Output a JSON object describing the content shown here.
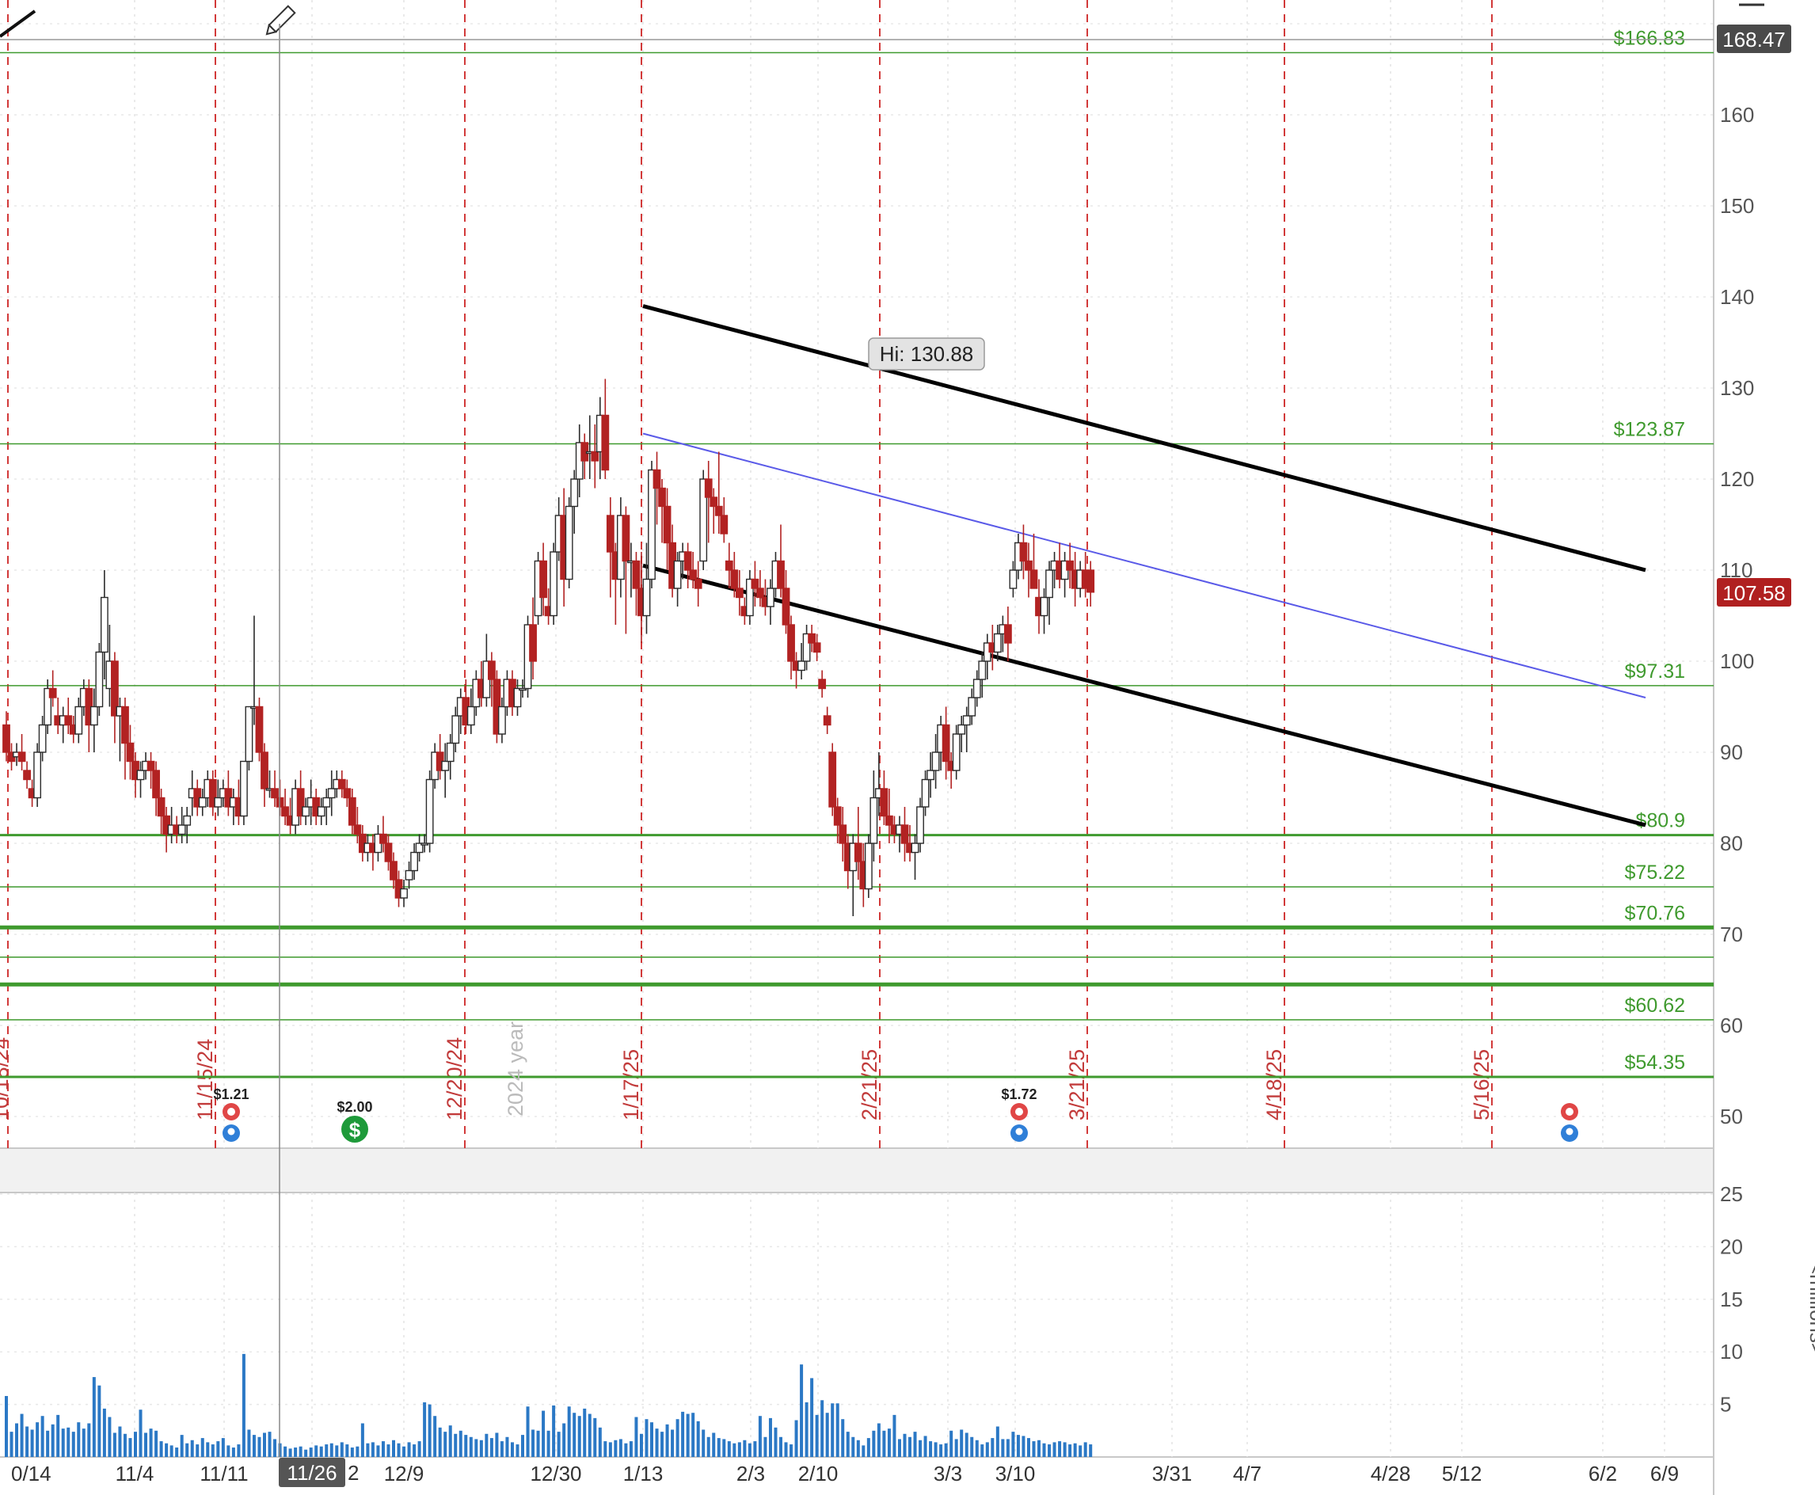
{
  "chart_data": {
    "type": "candlestick",
    "price_axis": {
      "ticks": [
        "160",
        "150",
        "140",
        "130",
        "120",
        "110",
        "100",
        "90",
        "80",
        "70",
        "60",
        "50"
      ],
      "tick_values": [
        160,
        150,
        140,
        130,
        120,
        110,
        100,
        90,
        80,
        70,
        60,
        50
      ],
      "ylim": [
        46,
        172
      ]
    },
    "volume_axis": {
      "ticks": [
        "25",
        "20",
        "15",
        "10",
        "5"
      ],
      "tick_values": [
        25,
        20,
        15,
        10,
        5
      ],
      "unit_label": "<millions>",
      "ylim": [
        0,
        27
      ]
    },
    "x_axis": {
      "ticks": [
        "0/14",
        "11/4",
        "11/11",
        "11/26",
        "12/9",
        "12/30",
        "1/13",
        "2/3",
        "2/10",
        "3/3",
        "3/10",
        "3/31",
        "4/7",
        "4/28",
        "5/12",
        "6/2",
        "6/9"
      ],
      "selected_tick": "11/26",
      "selected_tick_suffix": "2",
      "year_marker": "2024 year"
    },
    "current_price": "107.58",
    "cursor_price": "168.47",
    "high_annotation": "Hi: 130.88",
    "price_levels": [
      {
        "label": "$166.83",
        "value": 166.83,
        "weight": "thin"
      },
      {
        "label": "$123.87",
        "value": 123.87,
        "weight": "thin"
      },
      {
        "label": "$97.31",
        "value": 97.31,
        "weight": "thin"
      },
      {
        "label": "$80.9",
        "value": 80.9,
        "weight": "medium"
      },
      {
        "label": "$75.22",
        "value": 75.22,
        "weight": "thin"
      },
      {
        "label": "$70.76",
        "value": 70.76,
        "weight": "thick"
      },
      {
        "label": "",
        "value": 67.5,
        "weight": "thin"
      },
      {
        "label": "",
        "value": 64.5,
        "weight": "thick"
      },
      {
        "label": "$60.62",
        "value": 60.62,
        "weight": "thin"
      },
      {
        "label": "$54.35",
        "value": 54.35,
        "weight": "medium"
      }
    ],
    "event_dates": [
      "11/15/24",
      "12/20/24",
      "1/17/25",
      "2/21/25",
      "3/21/25",
      "4/18/25",
      "5/16/25"
    ],
    "partial_event_date": "10/18/24",
    "dividends": [
      {
        "label": "$1.21"
      },
      {
        "label": "$2.00"
      },
      {
        "label": "$1.72"
      }
    ],
    "channel": {
      "upper": {
        "start": [
          "1/17",
          139
        ],
        "end": [
          "5/30",
          110
        ]
      },
      "middle": {
        "start": [
          "1/17",
          125
        ],
        "end": [
          "5/30",
          96
        ]
      },
      "lower": {
        "start": [
          "1/17",
          110.5
        ],
        "end": [
          "5/30",
          82
        ]
      }
    },
    "candles": [
      [
        93,
        94.5,
        89,
        90
      ],
      [
        90,
        91,
        88,
        89
      ],
      [
        89.5,
        91,
        88.5,
        90
      ],
      [
        90,
        92,
        88,
        89
      ],
      [
        88,
        89,
        86,
        87
      ],
      [
        86,
        87,
        84,
        85
      ],
      [
        85,
        91,
        84,
        90
      ],
      [
        90,
        94,
        89,
        93
      ],
      [
        93,
        98,
        92,
        97
      ],
      [
        97,
        99,
        95,
        96
      ],
      [
        94,
        96,
        92,
        93
      ],
      [
        93,
        95,
        91,
        94
      ],
      [
        94,
        96,
        92,
        93
      ],
      [
        93,
        94,
        91,
        92
      ],
      [
        92,
        96,
        91,
        95
      ],
      [
        95,
        98,
        94,
        97
      ],
      [
        97,
        98,
        90,
        93
      ],
      [
        93,
        97,
        90,
        95
      ],
      [
        95,
        102,
        94,
        101
      ],
      [
        101,
        110,
        98,
        107
      ],
      [
        97,
        104,
        95,
        100
      ],
      [
        100,
        101,
        91,
        94
      ],
      [
        94,
        96,
        89,
        95
      ],
      [
        95,
        96,
        87,
        91
      ],
      [
        91,
        93,
        87,
        89
      ],
      [
        89,
        90,
        85,
        87
      ],
      [
        87,
        89,
        85,
        88
      ],
      [
        88,
        90,
        87,
        89
      ],
      [
        89,
        90,
        86,
        88
      ],
      [
        88,
        89,
        83,
        85
      ],
      [
        85,
        86,
        81,
        83
      ],
      [
        83,
        84,
        79,
        81
      ],
      [
        81,
        84,
        80,
        82
      ],
      [
        82,
        83,
        80,
        81
      ],
      [
        81,
        84,
        80,
        82
      ],
      [
        82,
        84,
        80,
        83
      ],
      [
        85,
        88,
        83,
        86
      ],
      [
        86,
        87,
        83,
        84
      ],
      [
        84,
        86,
        83,
        85
      ],
      [
        85,
        88,
        84,
        87
      ],
      [
        87,
        88,
        83,
        84
      ],
      [
        84,
        87,
        83,
        85
      ],
      [
        85,
        87,
        84,
        86
      ],
      [
        86,
        88,
        83,
        84
      ],
      [
        84,
        86,
        82,
        85
      ],
      [
        85,
        87,
        82,
        83
      ],
      [
        83,
        88,
        82,
        89
      ],
      [
        89,
        92,
        88,
        95
      ],
      [
        95,
        105,
        93,
        95
      ],
      [
        95,
        96,
        89,
        90
      ],
      [
        90,
        91,
        84,
        86
      ],
      [
        86,
        88,
        85,
        86
      ],
      [
        86,
        88,
        84,
        85
      ],
      [
        85,
        87,
        83,
        84
      ],
      [
        84,
        86,
        82,
        83
      ],
      [
        83,
        85,
        81,
        82
      ],
      [
        82,
        87,
        81,
        86
      ],
      [
        86,
        88,
        82,
        83
      ],
      [
        83,
        85,
        82,
        84
      ],
      [
        84,
        87,
        82,
        85
      ],
      [
        85,
        86,
        82,
        83
      ],
      [
        83,
        85,
        82,
        84
      ],
      [
        84,
        86,
        82,
        85
      ],
      [
        85,
        88,
        83,
        86
      ],
      [
        86,
        88,
        85,
        87
      ],
      [
        87,
        88,
        85,
        86
      ],
      [
        86,
        87,
        84,
        85
      ],
      [
        85,
        86,
        81,
        82
      ],
      [
        82,
        84,
        80,
        81
      ],
      [
        81,
        82,
        78,
        79
      ],
      [
        79,
        81,
        78,
        80
      ],
      [
        80,
        81,
        77,
        79
      ],
      [
        79,
        82,
        78,
        81
      ],
      [
        81,
        83,
        79,
        80
      ],
      [
        80,
        81,
        77,
        78
      ],
      [
        78,
        79,
        75,
        76
      ],
      [
        76,
        77,
        73,
        74
      ],
      [
        74,
        76,
        73,
        75
      ],
      [
        76,
        78,
        75,
        77
      ],
      [
        77,
        80,
        76,
        79
      ],
      [
        79,
        81,
        78,
        80
      ],
      [
        80,
        81,
        79,
        80
      ],
      [
        80,
        88,
        79,
        87
      ],
      [
        87,
        91,
        86,
        90
      ],
      [
        90,
        92,
        87,
        88
      ],
      [
        88,
        91,
        85,
        89
      ],
      [
        89,
        92,
        87,
        91
      ],
      [
        91,
        95,
        90,
        94
      ],
      [
        94,
        97,
        92,
        96
      ],
      [
        96,
        98,
        92,
        93
      ],
      [
        93,
        97,
        92,
        95
      ],
      [
        95,
        99,
        94,
        98
      ],
      [
        98,
        100,
        95,
        96
      ],
      [
        96,
        103,
        95,
        100
      ],
      [
        100,
        101,
        95,
        98
      ],
      [
        98,
        99,
        91,
        92
      ],
      [
        92,
        96,
        91,
        95
      ],
      [
        95,
        99,
        94,
        98
      ],
      [
        98,
        99,
        94,
        95
      ],
      [
        95,
        98,
        94,
        97
      ],
      [
        97,
        98,
        96,
        97
      ],
      [
        97,
        105,
        96,
        104
      ],
      [
        104,
        107,
        98,
        100
      ],
      [
        105,
        112,
        104,
        111
      ],
      [
        111,
        113,
        105,
        107
      ],
      [
        106,
        108,
        104,
        105
      ],
      [
        105,
        113,
        104,
        112
      ],
      [
        112,
        118,
        111,
        116
      ],
      [
        116,
        119,
        106,
        109
      ],
      [
        109,
        118,
        108,
        117
      ],
      [
        117,
        121,
        114,
        120
      ],
      [
        120,
        126,
        118,
        124
      ],
      [
        124,
        125,
        120,
        122
      ],
      [
        123,
        127,
        120,
        123
      ],
      [
        123,
        126,
        119,
        122
      ],
      [
        123,
        129,
        120,
        127
      ],
      [
        127,
        131,
        120,
        121
      ],
      [
        116,
        118,
        107,
        112
      ],
      [
        112,
        113,
        104,
        109
      ],
      [
        109,
        118,
        107,
        116
      ],
      [
        116,
        117,
        103,
        111
      ],
      [
        111,
        113,
        107,
        111
      ],
      [
        111,
        112,
        105,
        108
      ],
      [
        108,
        112,
        102,
        105
      ],
      [
        105,
        113,
        103,
        109
      ],
      [
        109,
        122,
        108,
        121
      ],
      [
        121,
        123,
        115,
        119
      ],
      [
        119,
        120,
        113,
        117
      ],
      [
        117,
        119,
        110,
        113
      ],
      [
        113,
        115,
        107,
        108
      ],
      [
        108,
        112,
        106,
        111
      ],
      [
        111,
        113,
        109,
        112
      ],
      [
        112,
        113,
        108,
        110
      ],
      [
        110,
        112,
        108,
        109
      ],
      [
        109,
        111,
        106,
        108
      ],
      [
        111,
        121,
        110,
        120
      ],
      [
        120,
        122,
        113,
        118
      ],
      [
        118,
        119,
        114,
        117
      ],
      [
        117,
        123,
        114,
        116
      ],
      [
        116,
        118,
        113,
        114
      ],
      [
        111,
        113,
        108,
        110
      ],
      [
        110,
        112,
        107,
        108
      ],
      [
        108,
        110,
        105,
        107
      ],
      [
        106,
        107,
        104,
        105
      ],
      [
        105,
        110,
        104,
        109
      ],
      [
        109,
        111,
        106,
        108
      ],
      [
        108,
        110,
        106,
        107
      ],
      [
        107,
        109,
        105,
        106
      ],
      [
        106,
        109,
        104,
        108
      ],
      [
        108,
        112,
        107,
        111
      ],
      [
        111,
        115,
        107,
        108
      ],
      [
        108,
        110,
        103,
        104
      ],
      [
        104,
        105,
        98,
        100
      ],
      [
        100,
        101,
        97,
        99
      ],
      [
        99,
        102,
        98,
        100
      ],
      [
        100,
        104,
        99,
        103
      ],
      [
        103,
        104,
        101,
        102
      ],
      [
        102,
        103,
        100,
        101
      ],
      [
        98,
        99,
        96,
        97
      ],
      [
        94,
        95,
        92,
        93
      ],
      [
        90,
        91,
        83,
        84
      ],
      [
        84,
        85,
        80,
        82
      ],
      [
        82,
        84,
        78,
        80
      ],
      [
        80,
        81,
        75,
        77
      ],
      [
        77,
        81,
        72,
        80
      ],
      [
        80,
        84,
        76,
        78
      ],
      [
        78,
        80,
        73,
        75
      ],
      [
        75,
        81,
        74,
        80
      ],
      [
        80,
        88,
        78,
        85
      ],
      [
        85,
        90,
        83,
        86
      ],
      [
        86,
        88,
        82,
        83
      ],
      [
        83,
        86,
        80,
        82
      ],
      [
        82,
        83,
        80,
        81
      ],
      [
        81,
        83,
        79,
        82
      ],
      [
        82,
        84,
        78,
        80
      ],
      [
        80,
        82,
        78,
        79
      ],
      [
        79,
        81,
        76,
        80
      ],
      [
        80,
        85,
        79,
        84
      ],
      [
        84,
        88,
        83,
        87
      ],
      [
        87,
        90,
        85,
        88
      ],
      [
        88,
        92,
        86,
        90
      ],
      [
        90,
        94,
        88,
        93
      ],
      [
        93,
        95,
        87,
        89
      ],
      [
        89,
        90,
        86,
        88
      ],
      [
        88,
        93,
        87,
        92
      ],
      [
        92,
        94,
        90,
        93
      ],
      [
        93,
        95,
        90,
        94
      ],
      [
        94,
        97,
        93,
        96
      ],
      [
        96,
        99,
        95,
        98
      ],
      [
        98,
        101,
        96,
        100
      ],
      [
        100,
        103,
        98,
        102
      ],
      [
        102,
        104,
        99,
        101
      ],
      [
        101,
        104,
        100,
        103
      ],
      [
        103,
        105,
        101,
        104
      ],
      [
        104,
        106,
        100,
        102
      ],
      [
        108,
        111,
        107,
        110
      ],
      [
        110,
        114,
        109,
        113
      ],
      [
        113,
        115,
        109,
        111
      ],
      [
        111,
        113,
        107,
        110
      ],
      [
        110,
        114,
        108,
        108
      ],
      [
        107,
        109,
        103,
        105
      ],
      [
        105,
        108,
        103,
        107
      ],
      [
        107,
        111,
        104,
        110
      ],
      [
        110,
        112,
        108,
        111
      ],
      [
        111,
        113,
        108,
        109
      ],
      [
        109,
        112,
        107,
        111
      ],
      [
        111,
        113,
        108,
        110
      ],
      [
        110,
        112,
        106,
        108
      ],
      [
        108,
        111,
        107,
        110
      ],
      [
        110,
        112,
        107,
        108
      ],
      [
        110,
        111,
        106,
        107.58
      ]
    ],
    "volumes": [
      5.8,
      2.4,
      3.2,
      4.1,
      2.9,
      2.6,
      3.3,
      3.9,
      2.5,
      3.1,
      4,
      2.7,
      2.8,
      2.4,
      3.3,
      2.7,
      3.2,
      7.6,
      6.8,
      4.6,
      3.8,
      2.3,
      2.9,
      2.2,
      1.8,
      2.4,
      4.5,
      2.3,
      2.7,
      2.5,
      1.5,
      1.3,
      1.1,
      0.9,
      2.1,
      1.3,
      1.6,
      1.2,
      1.8,
      1.4,
      1.2,
      1.5,
      1.8,
      1.1,
      0.9,
      1.2,
      9.8,
      2.6,
      2.1,
      1.9,
      2.3,
      2.4,
      1.7,
      1.3,
      1,
      0.8,
      0.9,
      1,
      0.7,
      0.9,
      1.1,
      1,
      1.2,
      1.3,
      1.1,
      1.4,
      1.2,
      0.9,
      1,
      3.2,
      1.3,
      1.4,
      1.1,
      1.5,
      1.2,
      1.6,
      1.3,
      1,
      1.4,
      1.2,
      1.5,
      5.2,
      5,
      3.9,
      2.8,
      2.4,
      3,
      2.2,
      2.5,
      2.1,
      1.9,
      1.7,
      1.6,
      2.2,
      1.8,
      2.3,
      1.5,
      1.9,
      1.4,
      1.2,
      2.1,
      4.8,
      2.6,
      2.5,
      4.4,
      2.5,
      4.9,
      2.4,
      3.2,
      4.8,
      4.2,
      3.9,
      4.6,
      4.1,
      3.7,
      2.8,
      1.5,
      1.4,
      1.6,
      1.7,
      1.3,
      1.5,
      3.8,
      2.2,
      3.6,
      3.3,
      2.7,
      2.4,
      3.1,
      2.6,
      3.6,
      4.3,
      4.1,
      4.2,
      3.4,
      2.6,
      1.9,
      2.3,
      1.8,
      1.7,
      1.5,
      1.3,
      1.4,
      1.6,
      1.3,
      1.5,
      3.9,
      1.9,
      3.7,
      2.8,
      1.9,
      1.4,
      1.2,
      3.5,
      8.8,
      5.2,
      7.5,
      4,
      5.4,
      4.2,
      5.1,
      5.1,
      3.6,
      2.4,
      1.9,
      1.6,
      1.1,
      1.8,
      2.5,
      3.2,
      2.5,
      2.7,
      4,
      1.7,
      2.2,
      1.9,
      2.4,
      1.6,
      2,
      1.5,
      1.4,
      1.2,
      1.3,
      2.5,
      1.7,
      2.6,
      2.3,
      1.9,
      1.6,
      1.2,
      1.4,
      1.8,
      2.9,
      1.7,
      1.7,
      2.4,
      2.1,
      2,
      1.8,
      1.5,
      1.6,
      1.3,
      1.2,
      1.4,
      1.5,
      1.4,
      1.2,
      1.3,
      1.1,
      1.4,
      1.2
    ]
  },
  "colors": {
    "up_body": "#ffffff",
    "up_stroke": "#2b2b2b",
    "down_body": "#b22222",
    "level_line": "#3f9a2e",
    "event_line": "#d23a3a",
    "channel_outer": "#000000",
    "channel_mid": "#5a5ae8",
    "volume_bar": "#2b78c5",
    "current_price_bg": "#b02020",
    "cursor_price_bg": "#4a4a4a"
  }
}
